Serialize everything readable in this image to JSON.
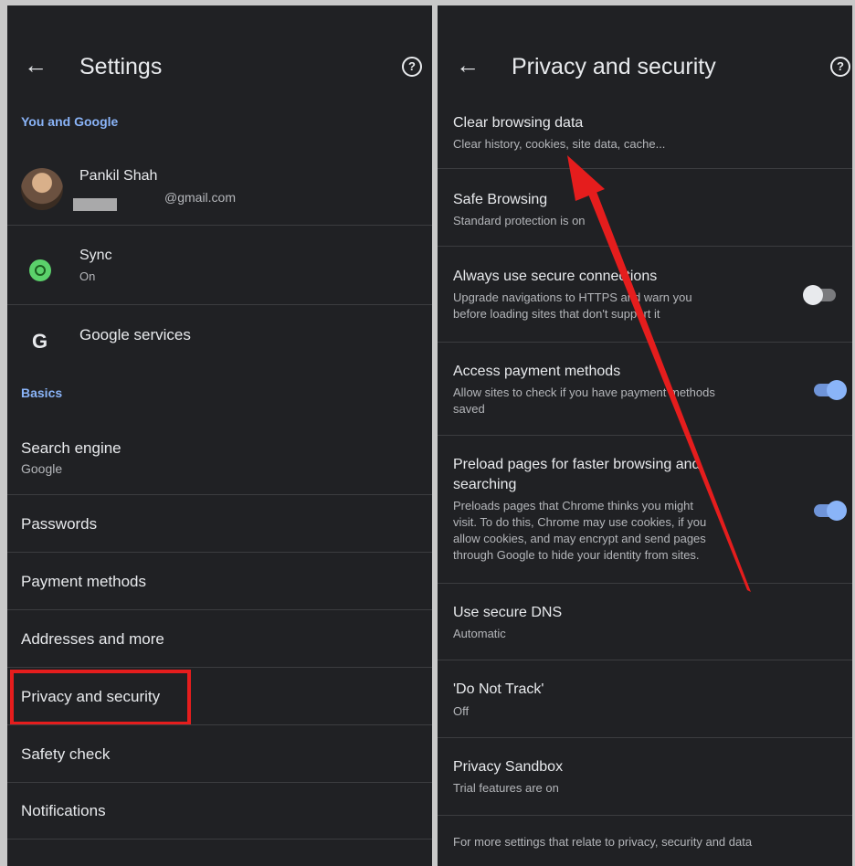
{
  "left": {
    "title": "Settings",
    "section_you": "You and Google",
    "account": {
      "name": "Pankil Shah",
      "email": "@gmail.com"
    },
    "sync": {
      "label": "Sync",
      "status": "On"
    },
    "google_services": "Google services",
    "section_basics": "Basics",
    "search_engine": {
      "label": "Search engine",
      "value": "Google"
    },
    "items": [
      "Passwords",
      "Payment methods",
      "Addresses and more",
      "Privacy and security",
      "Safety check",
      "Notifications"
    ]
  },
  "right": {
    "title": "Privacy and security",
    "clear": {
      "label": "Clear browsing data",
      "sub": "Clear history, cookies, site data, cache..."
    },
    "safe": {
      "label": "Safe Browsing",
      "sub": "Standard protection is on"
    },
    "secure_conn": {
      "label": "Always use secure connections",
      "sub1": "Upgrade navigations to HTTPS and warn you",
      "sub2": "before loading sites that don't support it",
      "enabled": false
    },
    "payment": {
      "label": "Access payment methods",
      "sub1": "Allow sites to check if you have payment methods",
      "sub2": "saved",
      "enabled": true
    },
    "preload": {
      "label1": "Preload pages for faster browsing and",
      "label2": "searching",
      "sub1": "Preloads pages that Chrome thinks you might",
      "sub2": "visit. To do this, Chrome may use cookies, if you",
      "sub3": "allow cookies, and may encrypt and send pages",
      "sub4": "through Google to hide your identity from sites.",
      "enabled": true
    },
    "dns": {
      "label": "Use secure DNS",
      "sub": "Automatic"
    },
    "dnt": {
      "label": "'Do Not Track'",
      "sub": "Off"
    },
    "sandbox": {
      "label": "Privacy Sandbox",
      "sub": "Trial features are on"
    },
    "footer": "For more settings that relate to privacy, security and data"
  },
  "icons": {
    "back": "back-arrow-icon",
    "help": "help-icon",
    "sync": "sync-icon",
    "google": "google-g-icon"
  },
  "colors": {
    "background": "#202124",
    "accent": "#8ab4f8",
    "highlight": "#e51d1d",
    "annotation_arrow": "#e51d1d"
  }
}
